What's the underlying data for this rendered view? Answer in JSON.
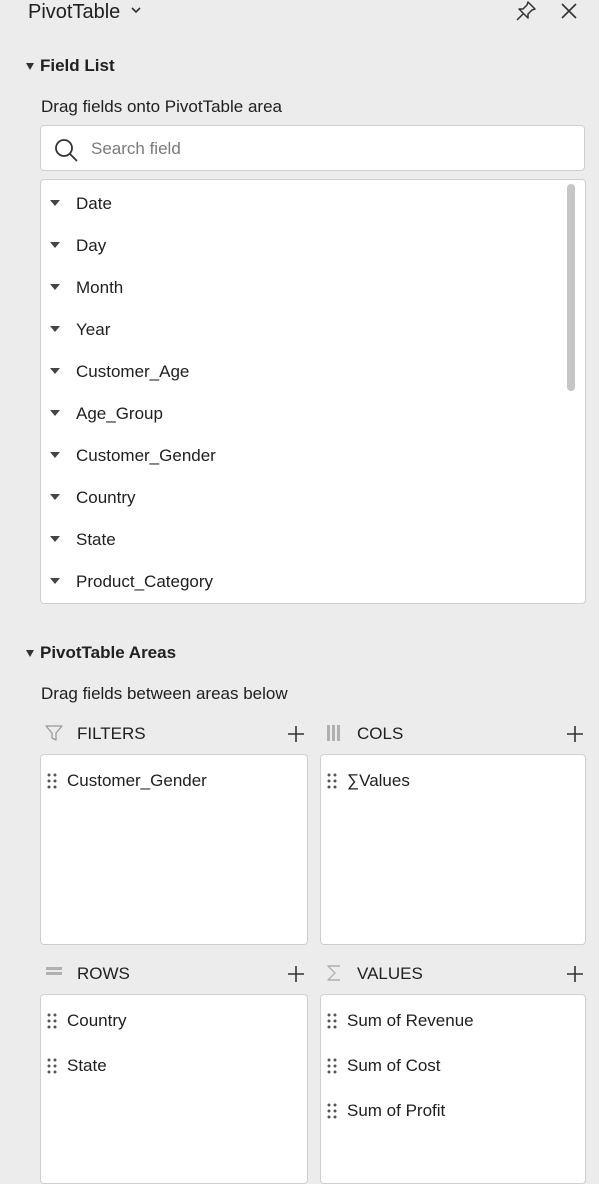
{
  "header": {
    "title": "PivotTable"
  },
  "field_list": {
    "title": "Field List",
    "hint": "Drag fields onto PivotTable area",
    "search_placeholder": "Search field",
    "fields": [
      "Date",
      "Day",
      "Month",
      "Year",
      "Customer_Age",
      "Age_Group",
      "Customer_Gender",
      "Country",
      "State",
      "Product_Category"
    ]
  },
  "areas": {
    "title": "PivotTable Areas",
    "hint": "Drag fields between areas below",
    "filters": {
      "label": "FILTERS",
      "items": [
        "Customer_Gender"
      ]
    },
    "cols": {
      "label": "COLS",
      "items": [
        "∑Values"
      ]
    },
    "rows": {
      "label": "ROWS",
      "items": [
        "Country",
        "State"
      ]
    },
    "values": {
      "label": "VALUES",
      "items": [
        "Sum of Revenue",
        "Sum of Cost",
        "Sum of Profit"
      ]
    }
  }
}
